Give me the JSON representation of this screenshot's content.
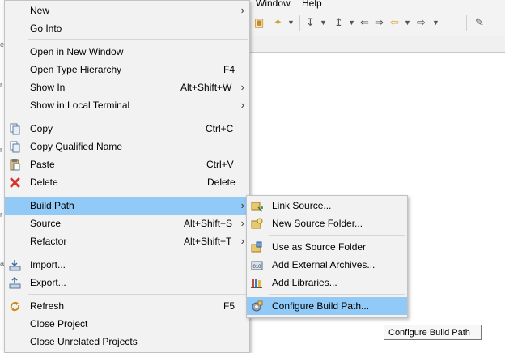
{
  "menubar": {
    "window": "Window",
    "help": "Help"
  },
  "context_menu": {
    "new": "New",
    "go_into": "Go Into",
    "open_new_window": "Open in New Window",
    "open_type_hierarchy": "Open Type Hierarchy",
    "open_type_hierarchy_shortcut": "F4",
    "show_in": "Show In",
    "show_in_shortcut": "Alt+Shift+W",
    "show_in_local_terminal": "Show in Local Terminal",
    "copy": "Copy",
    "copy_shortcut": "Ctrl+C",
    "copy_qualified_name": "Copy Qualified Name",
    "paste": "Paste",
    "paste_shortcut": "Ctrl+V",
    "delete": "Delete",
    "delete_shortcut": "Delete",
    "build_path": "Build Path",
    "source": "Source",
    "source_shortcut": "Alt+Shift+S",
    "refactor": "Refactor",
    "refactor_shortcut": "Alt+Shift+T",
    "import": "Import...",
    "export": "Export...",
    "refresh": "Refresh",
    "refresh_shortcut": "F5",
    "close_project": "Close Project",
    "close_unrelated_projects": "Close Unrelated Projects"
  },
  "submenu": {
    "link_source": "Link Source...",
    "new_source_folder": "New Source Folder...",
    "use_as_source_folder": "Use as Source Folder",
    "add_external_archives": "Add External Archives...",
    "add_libraries": "Add Libraries...",
    "configure_build_path": "Configure Build Path..."
  },
  "tooltip": "Configure Build Path",
  "colors": {
    "menu_bg": "#f2f2f2",
    "highlight": "#91c9f7",
    "delete_red": "#d9322b"
  }
}
